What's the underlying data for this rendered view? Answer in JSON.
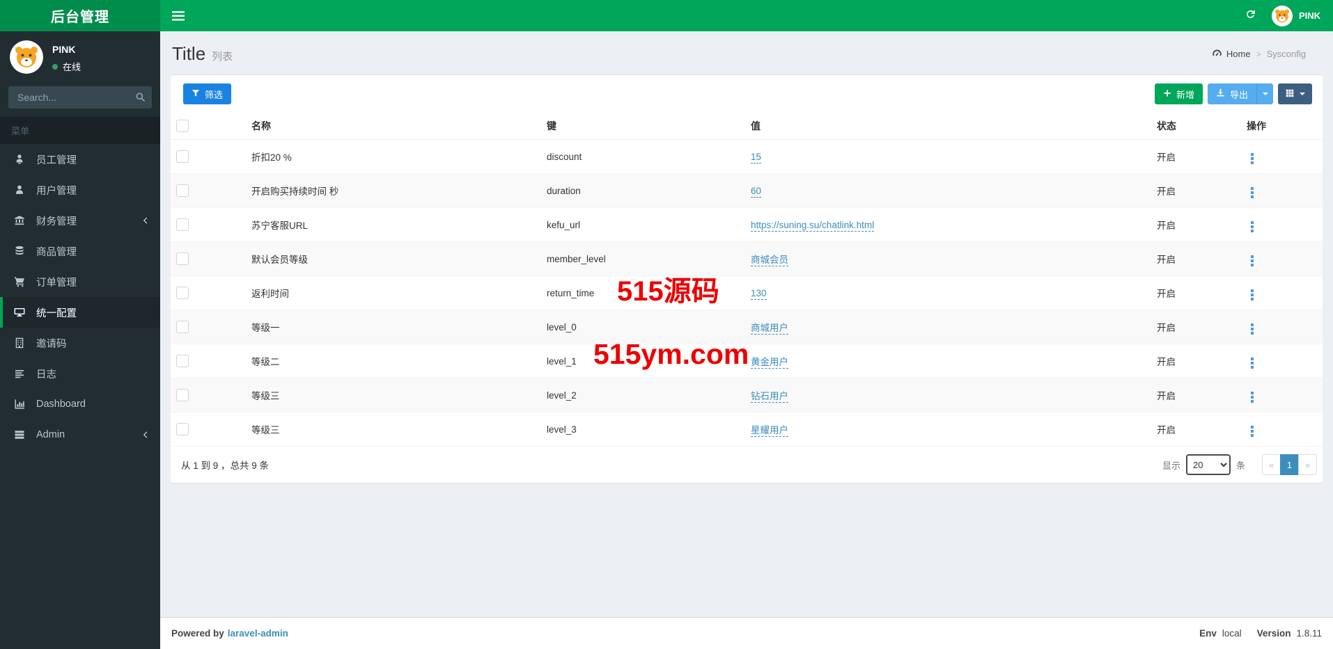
{
  "navbar": {
    "brand": "后台管理",
    "username": "PINK"
  },
  "sidebar": {
    "user": {
      "name": "PINK",
      "status": "在线"
    },
    "search_placeholder": "Search...",
    "menu_header": "菜单",
    "items": [
      {
        "label": "员工管理",
        "icon": "staff-icon",
        "active": false,
        "has_children": false
      },
      {
        "label": "用户管理",
        "icon": "user-icon",
        "active": false,
        "has_children": false
      },
      {
        "label": "财务管理",
        "icon": "bank-icon",
        "active": false,
        "has_children": true
      },
      {
        "label": "商品管理",
        "icon": "database-icon",
        "active": false,
        "has_children": false
      },
      {
        "label": "订单管理",
        "icon": "cart-icon",
        "active": false,
        "has_children": false
      },
      {
        "label": "统一配置",
        "icon": "desktop-icon",
        "active": true,
        "has_children": false
      },
      {
        "label": "邀请码",
        "icon": "building-icon",
        "active": false,
        "has_children": false
      },
      {
        "label": "日志",
        "icon": "log-list-icon",
        "active": false,
        "has_children": false
      },
      {
        "label": "Dashboard",
        "icon": "bar-chart-icon",
        "active": false,
        "has_children": false
      },
      {
        "label": "Admin",
        "icon": "server-icon",
        "active": false,
        "has_children": true
      }
    ]
  },
  "content_header": {
    "title": "Title",
    "subtitle": "列表"
  },
  "breadcrumb": {
    "home": "Home",
    "separator": ">",
    "current": "Sysconfig"
  },
  "toolbar": {
    "filter_label": "筛选",
    "add_label": "新增",
    "export_label": "导出"
  },
  "table": {
    "headers": [
      "名称",
      "键",
      "值",
      "状态",
      "操作"
    ],
    "rows": [
      {
        "name": "折扣20 %",
        "key": "discount",
        "value": "15",
        "status": "开启"
      },
      {
        "name": "开启购买持续时间 秒",
        "key": "duration",
        "value": "60",
        "status": "开启"
      },
      {
        "name": "苏宁客服URL",
        "key": "kefu_url",
        "value": "https://suning.su/chatlink.html",
        "status": "开启"
      },
      {
        "name": "默认会员等级",
        "key": "member_level",
        "value": "商城会员",
        "status": "开启"
      },
      {
        "name": "返利时间",
        "key": "return_time",
        "value": "130",
        "status": "开启"
      },
      {
        "name": "等级一",
        "key": "level_0",
        "value": "商城用户",
        "status": "开启"
      },
      {
        "name": "等级二",
        "key": "level_1",
        "value": "黄金用户",
        "status": "开启"
      },
      {
        "name": "等级三",
        "key": "level_2",
        "value": "钻石用户",
        "status": "开启"
      },
      {
        "name": "等级三",
        "key": "level_3",
        "value": "星耀用户",
        "status": "开启"
      }
    ]
  },
  "pagination": {
    "summary": "从 1 到 9 ，总共 9 条",
    "show_label": "显示",
    "per_page": "20",
    "unit_label": "条",
    "prev": "«",
    "page": "1",
    "next": "»"
  },
  "watermark": {
    "line1": "515源码",
    "line2": "515ym.com",
    "color": "#ee0000"
  },
  "footer": {
    "powered_by": "Powered by",
    "powered_link": "laravel-admin",
    "env_label": "Env",
    "env_value": "local",
    "version_label": "Version",
    "version_value": "1.8.11"
  },
  "colors": {
    "navbar_green": "#00a65a",
    "brand_green": "#008d4c",
    "sidebar_dark": "#222d32",
    "link_blue": "#3c8dbc",
    "filter_blue": "#1a82e2",
    "export_blue": "#55acee",
    "grid_slate": "#3c5e80",
    "watermark_red": "#ee0000"
  }
}
